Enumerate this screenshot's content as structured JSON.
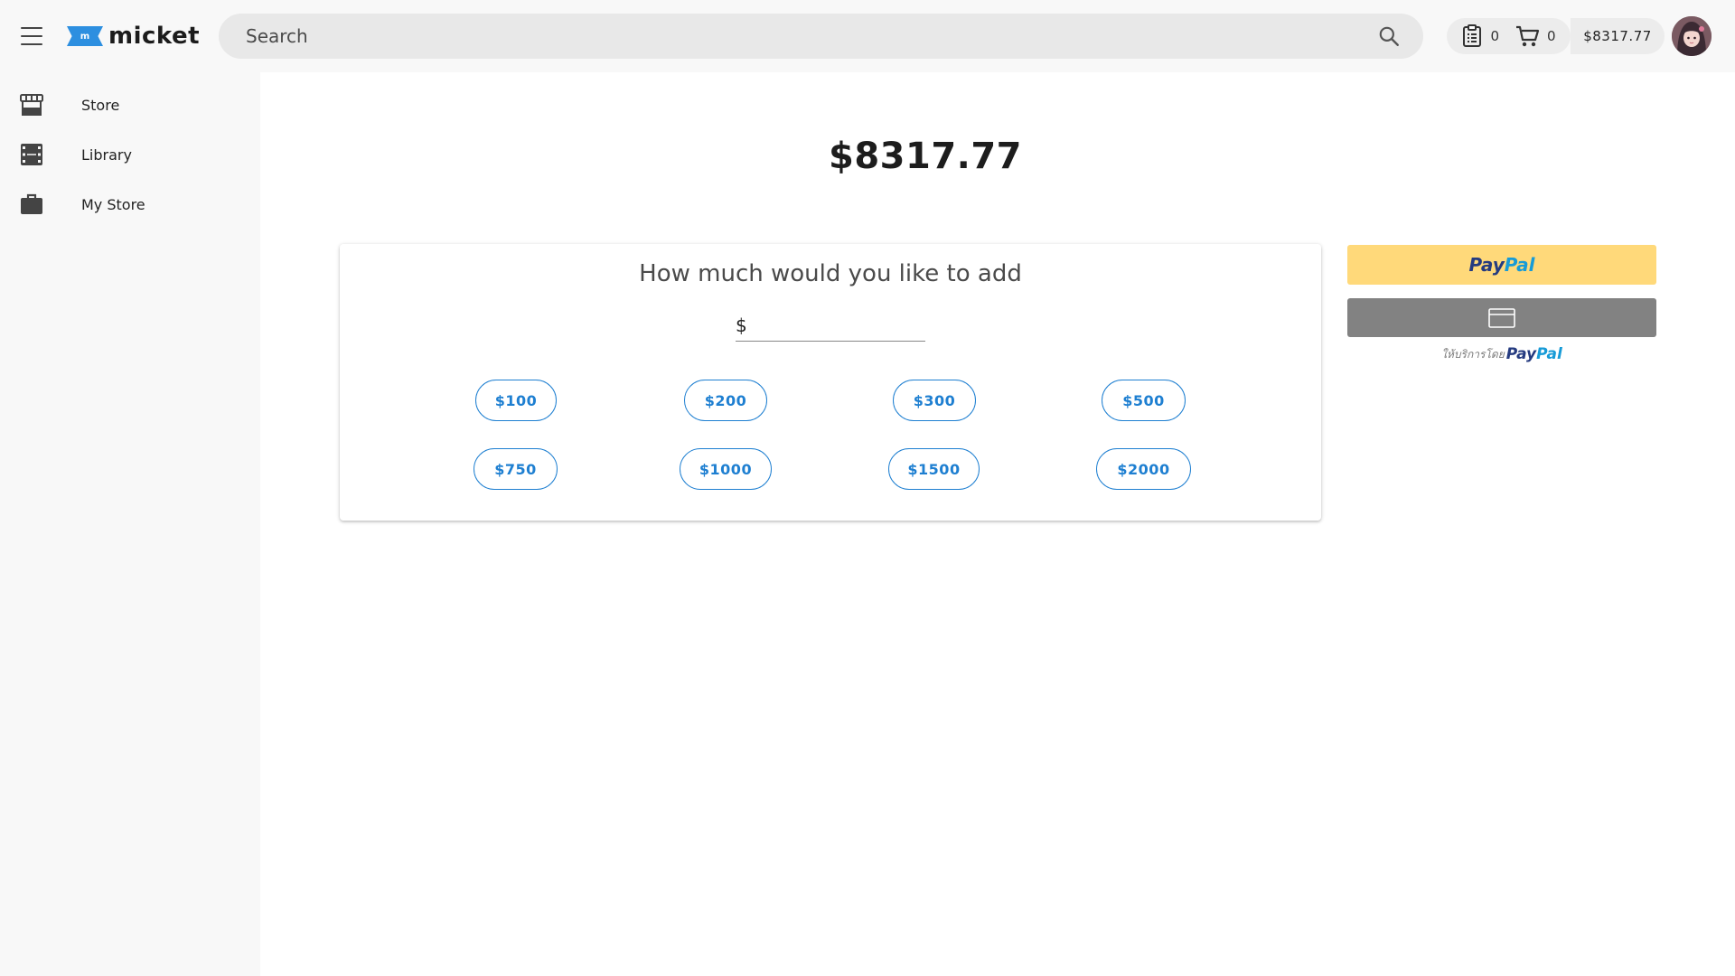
{
  "header": {
    "menu_icon": "hamburger-icon",
    "logo_text": "micket",
    "logo_mark_text": "m",
    "search": {
      "placeholder": "Search",
      "value": ""
    },
    "orders_count": "0",
    "cart_count": "0",
    "balance": "$8317.77"
  },
  "sidebar": {
    "items": [
      {
        "label": "Store",
        "icon": "storefront-icon"
      },
      {
        "label": "Library",
        "icon": "film-icon"
      },
      {
        "label": "My Store",
        "icon": "briefcase-icon"
      }
    ]
  },
  "main": {
    "balance": "$8317.77",
    "topup": {
      "title": "How much would you like to add",
      "currency_symbol": "$",
      "amount_value": "",
      "presets": [
        "$100",
        "$200",
        "$300",
        "$500",
        "$750",
        "$1000",
        "$1500",
        "$2000"
      ]
    },
    "payment": {
      "paypal_part1": "Pay",
      "paypal_part2": "Pal",
      "powered_prefix": "ให้บริการโดย",
      "powered_brand1": "Pay",
      "powered_brand2": "Pal"
    }
  },
  "colors": {
    "accent": "#1e7fd1",
    "paypal_yellow": "#ffd97a",
    "card_button_gray": "#828282",
    "paypal_dark": "#253b80",
    "paypal_light": "#179bd7"
  }
}
